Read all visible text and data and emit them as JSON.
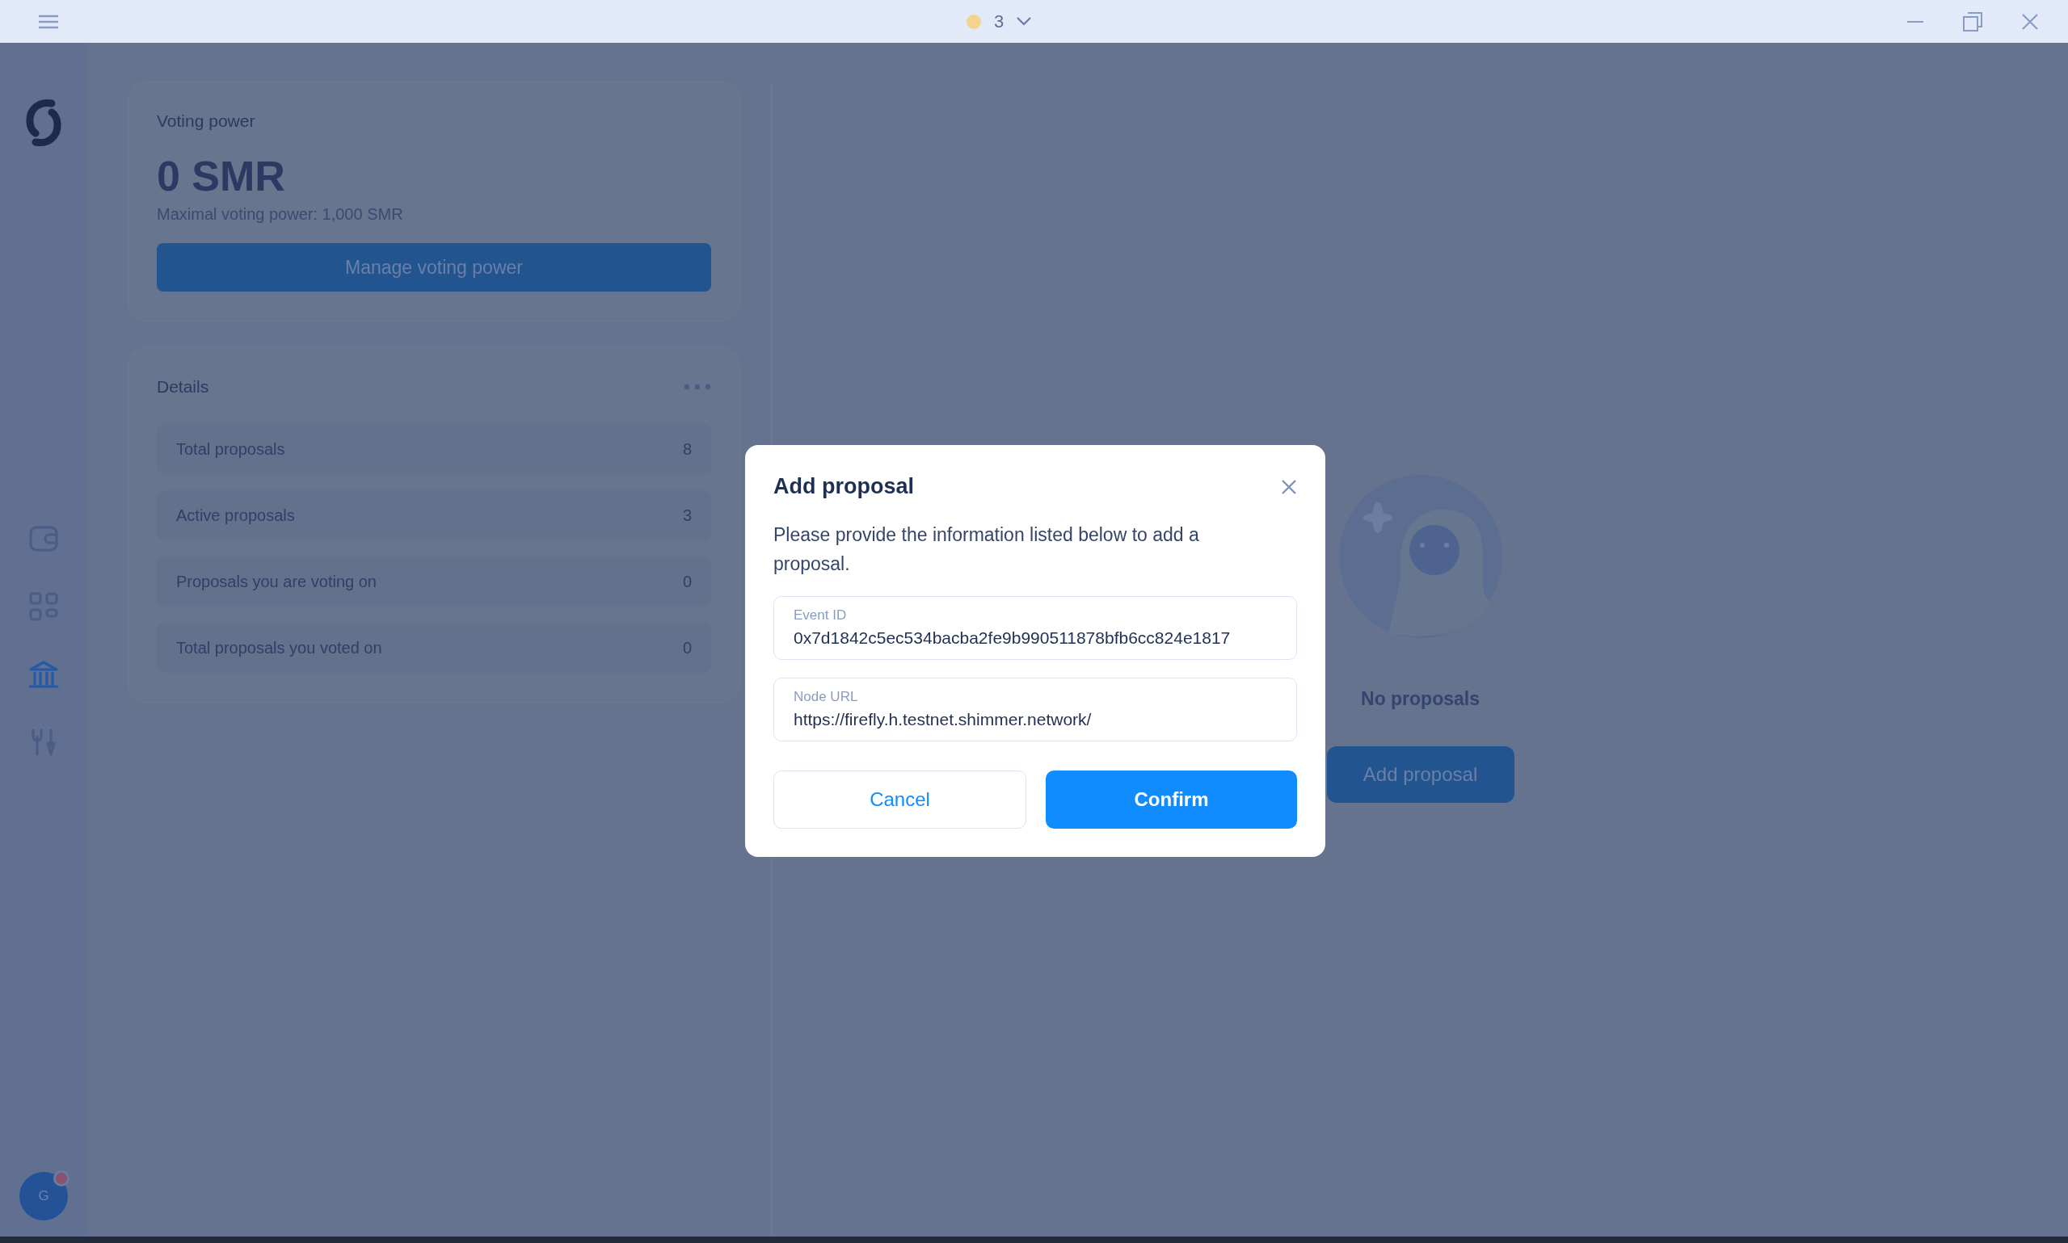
{
  "title_bar": {
    "count": "3"
  },
  "sidebar": {
    "items": [
      {
        "selected": false
      },
      {
        "selected": false
      },
      {
        "selected": true
      },
      {
        "selected": false
      }
    ]
  },
  "profile": {
    "initial": "G",
    "notification": true
  },
  "voting_power": {
    "title": "Voting power",
    "amount": "0 SMR",
    "maximal": "Maximal voting power: 1,000 SMR",
    "button": "Manage voting power"
  },
  "details": {
    "title": "Details",
    "rows": [
      {
        "label": "Total proposals",
        "value": "8"
      },
      {
        "label": "Active proposals",
        "value": "3"
      },
      {
        "label": "Proposals you are voting on",
        "value": "0"
      },
      {
        "label": "Total proposals you voted on",
        "value": "0"
      }
    ]
  },
  "proposals": {
    "empty_text": "No proposals",
    "button": "Add proposal"
  },
  "modal": {
    "title": "Add proposal",
    "description": "Please provide the information listed below to add a proposal.",
    "fields": [
      {
        "label": "Event ID",
        "value": "0x7d1842c5ec534bacba2fe9b990511878bfb6cc824e1817"
      },
      {
        "label": "Node URL",
        "value": "https://firefly.h.testnet.shimmer.network/"
      }
    ],
    "buttons": [
      {
        "label": "Cancel",
        "kind": "secondary"
      },
      {
        "label": "Confirm",
        "kind": "primary"
      }
    ]
  }
}
